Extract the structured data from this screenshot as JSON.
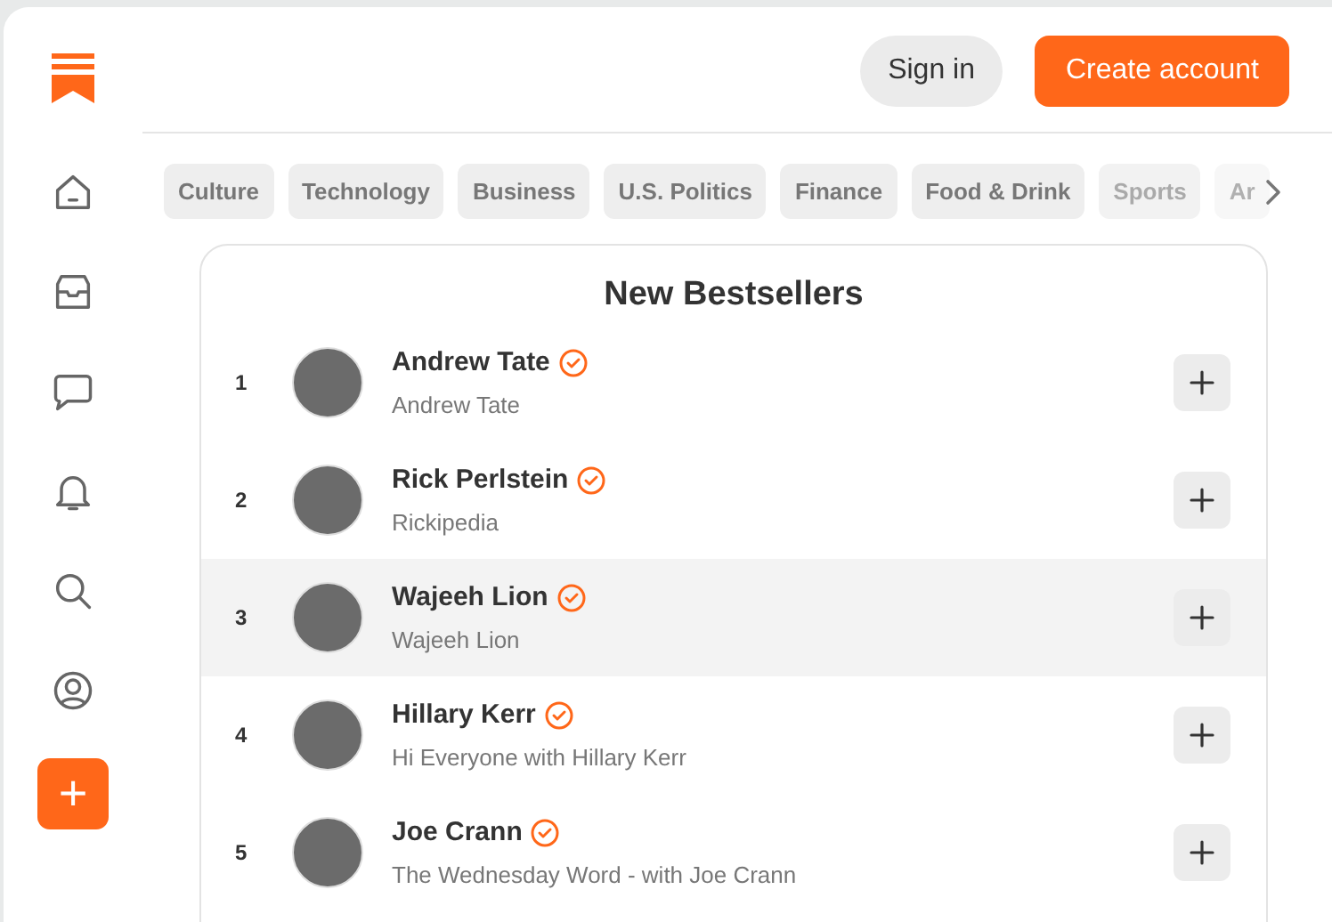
{
  "header": {
    "buttons": [
      {
        "label": "Sign in",
        "kind": "secondary"
      },
      {
        "label": "Create account",
        "kind": "primary"
      }
    ]
  },
  "sidebar": {
    "create_button": {
      "label": "+"
    }
  },
  "categories": [
    {
      "label": "Culture"
    },
    {
      "label": "Technology"
    },
    {
      "label": "Business"
    },
    {
      "label": "U.S. Politics"
    },
    {
      "label": "Finance"
    },
    {
      "label": "Food & Drink"
    },
    {
      "label": "Sports"
    },
    {
      "label": "Ar"
    }
  ],
  "bestsellers": {
    "title": "New Bestsellers",
    "rows": [
      {
        "rank": "1",
        "name": "Andrew Tate",
        "publication": "Andrew Tate",
        "verified": true,
        "highlighted": false
      },
      {
        "rank": "2",
        "name": "Rick Perlstein",
        "publication": "Rickipedia",
        "verified": true,
        "highlighted": false
      },
      {
        "rank": "3",
        "name": "Wajeeh Lion",
        "publication": "Wajeeh Lion",
        "verified": true,
        "highlighted": true
      },
      {
        "rank": "4",
        "name": "Hillary Kerr",
        "publication": "Hi Everyone with Hillary Kerr",
        "verified": true,
        "highlighted": false
      },
      {
        "rank": "5",
        "name": "Joe Crann",
        "publication": "The Wednesday Word - with Joe Crann",
        "verified": true,
        "highlighted": false
      }
    ]
  }
}
